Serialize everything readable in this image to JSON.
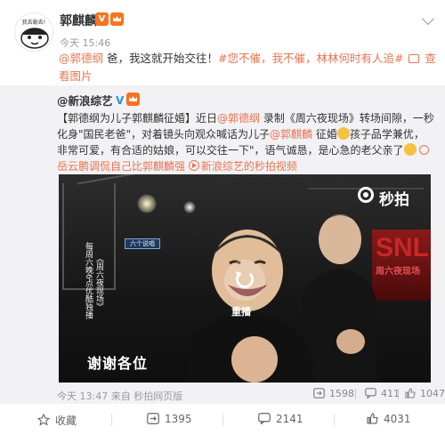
{
  "post": {
    "author": "郭麒麟",
    "vip_badge": "V",
    "avatar_caption": "我去勒去!",
    "timestamp": "今天 15:46",
    "text_mention": "@郭德纲",
    "text_body": " 爸，我这就开始交往！",
    "text_tags": "#您不催，我不催，林林何时有人追#",
    "text_pic_link": " 查看图片"
  },
  "repost": {
    "author": "@新浪综艺",
    "verified": "V",
    "text_part1": "【郭德纲为儿子郭麒麟征婚】近日",
    "mention1": "@郭德纲",
    "text_part2": " 录制《周六夜现场》转场间隙，一秒化身\"国民老爸\"，对着镜头向观众喊话为儿子",
    "mention2": "@郭麒麟",
    "text_part3": " 征婚",
    "text_part4": "孩子品学兼优，非常可爱，有合适的姑娘，可以交往一下\"，语气诚恳，是心急的老父亲了",
    "link1": "岳云鹏调侃自己比郭麒麟强",
    "link2": "新浪综艺的秒拍视频",
    "footer_time": "今天 13:47 来自 秒拍网页版",
    "forwards": "1598",
    "comments": "411",
    "likes": "1047"
  },
  "video": {
    "brand": "秒拍",
    "stage_sign": "六个说唱",
    "snl_text": "SNL",
    "snl_sub": "周六夜现场",
    "side_caption": "每周六晚6点优酷独播",
    "side_caption_show": "《周六夜现场》",
    "replay_label": "重播",
    "subtitle": "谢谢各位"
  },
  "actions": {
    "collect": "收藏",
    "forward": "1395",
    "comment": "2141",
    "like": "4031"
  },
  "colors": {
    "link": "#eb7350",
    "repost_bg": "#f2f2f5",
    "verified_blue": "#2b8fe8"
  }
}
